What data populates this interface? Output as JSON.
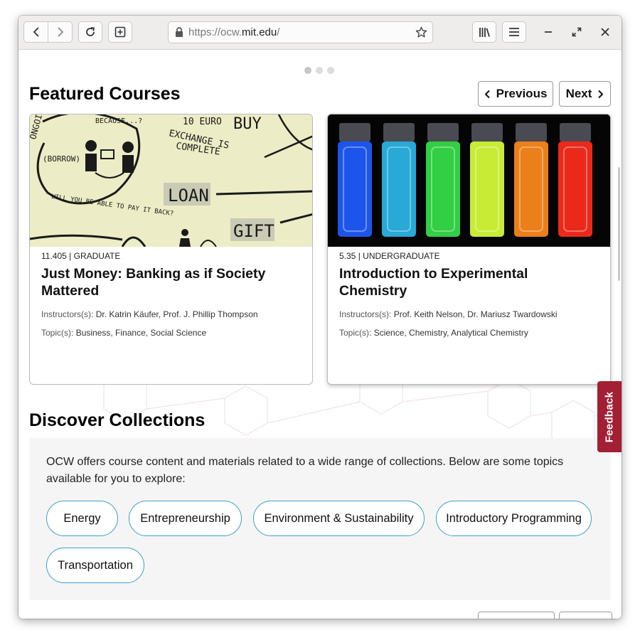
{
  "browser": {
    "url_prefix": "https://ocw.",
    "url_domain": "mit.edu",
    "url_suffix": "/"
  },
  "featured": {
    "title": "Featured Courses",
    "previous_label": "Previous",
    "next_label": "Next",
    "courses": [
      {
        "number": "11.405",
        "level": "GRADUATE",
        "title": "Just Money: Banking as if Society Mattered",
        "instructors_label": "Instructors(s):",
        "instructors": "Dr. Katrin Käufer, Prof. J. Phillip Thompson",
        "topics_label": "Topic(s):",
        "topics": "Business, Finance, Social Science",
        "image_words": [
          "ONGOING",
          "BECAUSE...?",
          "(BORROW)",
          "10 EURO",
          "EXCHANGE IS",
          "COMPLETE",
          "BUY",
          "LOAN",
          "GIFT",
          "WILL YOU BE ABLE TO PAY IT BACK?"
        ]
      },
      {
        "number": "5.35",
        "level": "UNDERGRADUATE",
        "title": "Introduction to Experimental Chemistry",
        "instructors_label": "Instructors(s):",
        "instructors": "Prof. Keith Nelson, Dr. Mariusz Twardowski",
        "topics_label": "Topic(s):",
        "topics": "Science, Chemistry, Analytical Chemistry",
        "vial_colors": [
          "#1f5cff",
          "#2bb7e8",
          "#36e04a",
          "#d9ff3a",
          "#ff8a1c",
          "#ff2d1c"
        ]
      }
    ]
  },
  "collections": {
    "title": "Discover Collections",
    "description": "OCW offers course content and materials related to a wide range of collections. Below are some topics available for you to explore:",
    "items": [
      "Energy",
      "Entrepreneurship",
      "Environment & Sustainability",
      "Introductory Programming",
      "Transportation"
    ]
  },
  "feedback_label": "Feedback",
  "colors": {
    "accent_red": "#a31f34",
    "pill_border": "#3aa0c8"
  },
  "icons": [
    "back-icon",
    "forward-icon",
    "reload-icon",
    "new-tab-icon",
    "lock-icon",
    "star-icon",
    "library-icon",
    "menu-icon",
    "minimize-icon",
    "maximize-icon",
    "close-icon"
  ]
}
